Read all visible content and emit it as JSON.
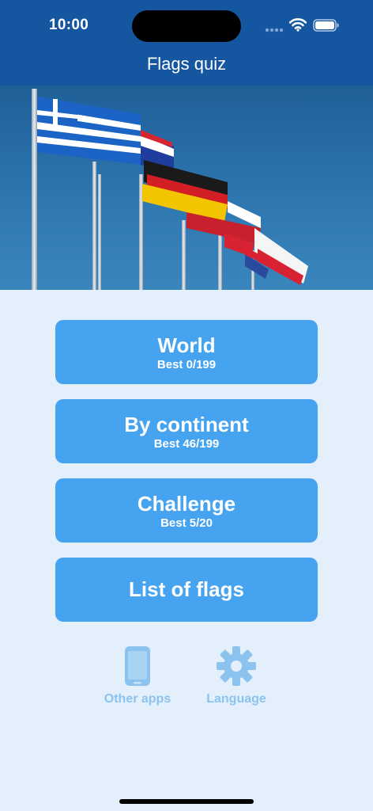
{
  "status": {
    "time": "10:00"
  },
  "header": {
    "title": "Flags quiz"
  },
  "menu": [
    {
      "label": "World",
      "best": "Best 0/199"
    },
    {
      "label": "By continent",
      "best": "Best 46/199"
    },
    {
      "label": "Challenge",
      "best": "Best 5/20"
    },
    {
      "label": "List of flags",
      "best": ""
    }
  ],
  "footer": {
    "other_apps": {
      "label": "Other apps",
      "icon": "smartphone-icon"
    },
    "language": {
      "label": "Language",
      "icon": "gear-icon"
    }
  },
  "colors": {
    "header": "#1556a0",
    "background": "#e3f0fb",
    "button": "#46a3f0",
    "footer_link": "#8cc3ee"
  }
}
